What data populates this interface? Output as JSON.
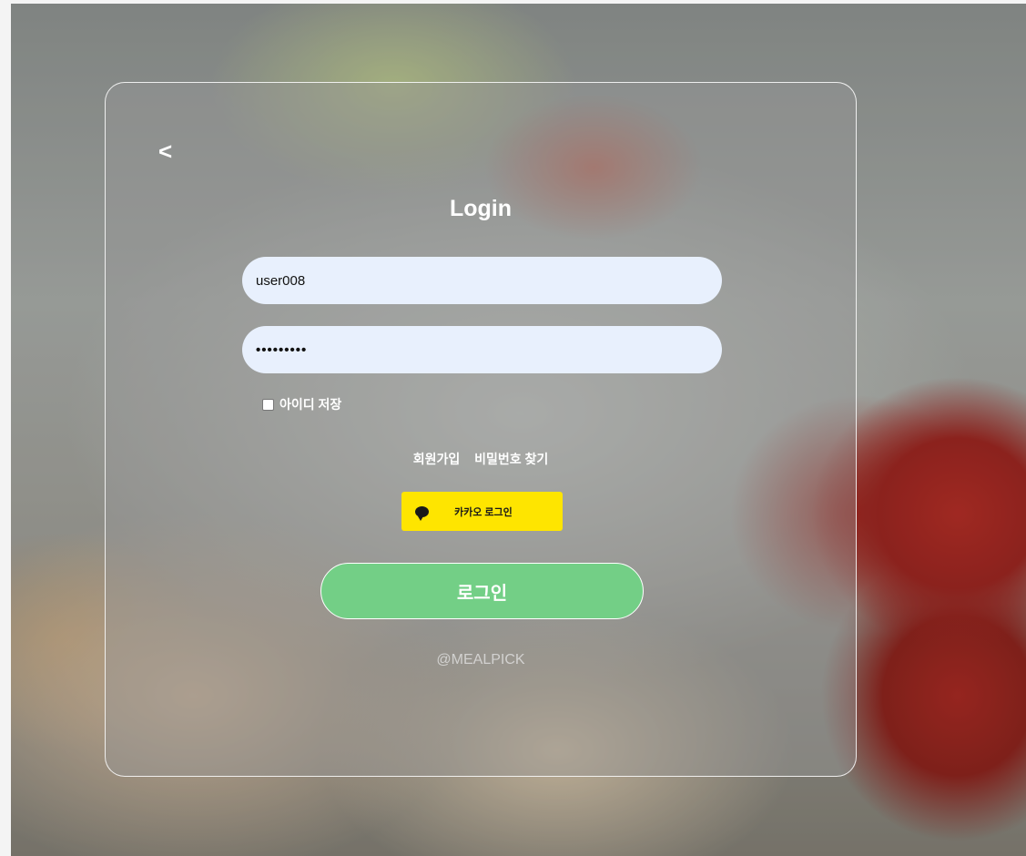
{
  "header": {
    "back_label": "<",
    "title": "Login"
  },
  "form": {
    "username_value": "user008",
    "password_value": "•••••••••",
    "remember_label": "아이디 저장",
    "remember_checked": false
  },
  "links": {
    "signup": "회원가입",
    "find_password": "비밀번호 찾기"
  },
  "kakao": {
    "label": "카카오 로그인",
    "icon": "speech-bubble-icon",
    "color": "#fee500"
  },
  "login_button": {
    "label": "로그인",
    "color": "#73cf86"
  },
  "footer": {
    "brand": "@MEALPICK"
  }
}
